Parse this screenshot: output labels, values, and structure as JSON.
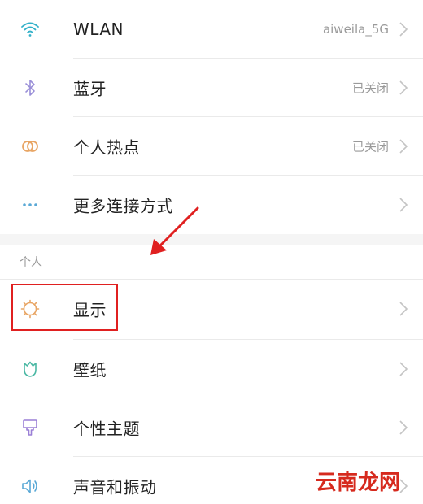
{
  "network_section": {
    "items": [
      {
        "label": "WLAN",
        "value": "aiweila_5G",
        "icon": "wifi-icon"
      },
      {
        "label": "蓝牙",
        "value": "已关闭",
        "icon": "bluetooth-icon"
      },
      {
        "label": "个人热点",
        "value": "已关闭",
        "icon": "hotspot-icon"
      },
      {
        "label": "更多连接方式",
        "value": "",
        "icon": "more-dots-icon"
      }
    ]
  },
  "personal_section": {
    "header": "个人",
    "items": [
      {
        "label": "显示",
        "icon": "display-sun-icon"
      },
      {
        "label": "壁纸",
        "icon": "wallpaper-tulip-icon"
      },
      {
        "label": "个性主题",
        "icon": "theme-brush-icon"
      },
      {
        "label": "声音和振动",
        "icon": "speaker-icon"
      }
    ]
  },
  "watermark": {
    "text": "云南龙网"
  },
  "colors": {
    "wifi": "#33b1c9",
    "bluetooth": "#9a8fd8",
    "hotspot": "#e8a564",
    "more": "#5aa9d6",
    "display": "#e8a564",
    "wallpaper": "#4bb8a4",
    "theme": "#9a7fd6",
    "sound": "#5aa9d6",
    "highlight": "#e02020",
    "arrow": "#e02020"
  }
}
